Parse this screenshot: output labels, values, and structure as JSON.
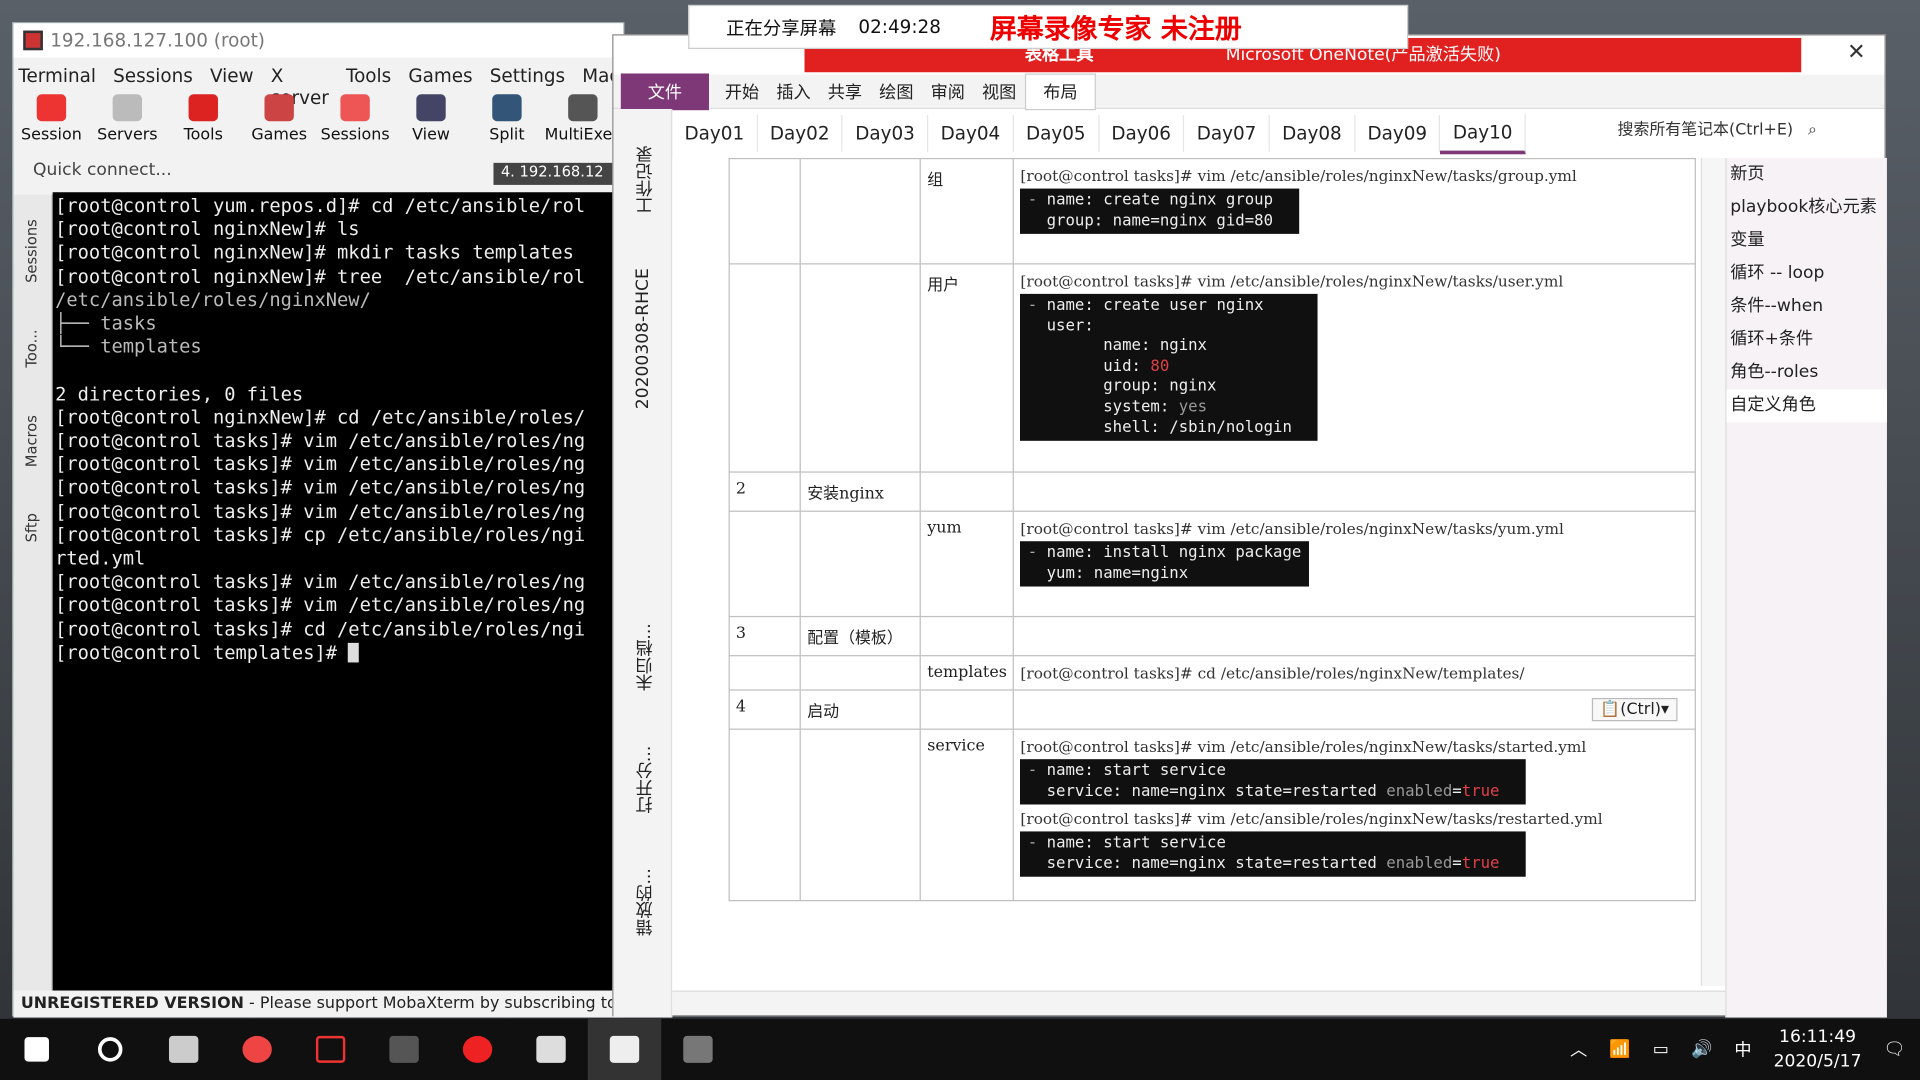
{
  "moba": {
    "title": "192.168.127.100 (root)",
    "menu": [
      "Terminal",
      "Sessions",
      "View",
      "X server",
      "Tools",
      "Games",
      "Settings",
      "Macros"
    ],
    "tools": [
      {
        "label": "Session",
        "color": "#e33"
      },
      {
        "label": "Servers",
        "color": "#bbb"
      },
      {
        "label": "Tools",
        "color": "#d22"
      },
      {
        "label": "Games",
        "color": "#c44"
      },
      {
        "label": "Sessions",
        "color": "#e55"
      },
      {
        "label": "View",
        "color": "#446"
      },
      {
        "label": "Split",
        "color": "#357"
      },
      {
        "label": "MultiExec",
        "color": "#555"
      }
    ],
    "quick_connect": "Quick connect...",
    "tab_label": "4. 192.168.12",
    "side_labels": {
      "sessions": "Sessions",
      "tools": "Too...",
      "macros": "Macros",
      "sftp": "Sftp"
    },
    "status": {
      "bold": "UNREGISTERED VERSION",
      "text": "-  Please support MobaXterm by subscribing to the p"
    },
    "terminal_lines": [
      "[root@control yum.repos.d]# cd /etc/ansible/rol",
      "[root@control nginxNew]# ls",
      "[root@control nginxNew]# mkdir tasks templates",
      "[root@control nginxNew]# tree  /etc/ansible/rol",
      "/etc/ansible/roles/nginxNew/",
      "├── tasks",
      "└── templates",
      "",
      "2 directories, 0 files",
      "[root@control nginxNew]# cd /etc/ansible/roles/",
      "[root@control tasks]# vim /etc/ansible/roles/ng",
      "[root@control tasks]# vim /etc/ansible/roles/ng",
      "[root@control tasks]# vim /etc/ansible/roles/ng",
      "[root@control tasks]# vim /etc/ansible/roles/ng",
      "[root@control tasks]# cp /etc/ansible/roles/ngi",
      "rted.yml",
      "[root@control tasks]# vim /etc/ansible/roles/ng",
      "[root@control tasks]# vim /etc/ansible/roles/ng",
      "[root@control tasks]# cd /etc/ansible/roles/ngi",
      "[root@control templates]# "
    ]
  },
  "share": {
    "label": "正在分享屏幕",
    "time": "02:49:28",
    "watermark": "屏幕录像专家 未注册"
  },
  "onenote": {
    "title_band": "Microsoft OneNote(产品激活失败)",
    "table_tools": "表格工具",
    "ribbon_tabs": [
      "文件",
      "开始",
      "插入",
      "共享",
      "绘图",
      "审阅",
      "视图",
      "布局"
    ],
    "notebook": "20200308-RHCE",
    "left_labels": {
      "work": "工作记录",
      "unfiled": "未归档...",
      "open": "打开分...",
      "misplaced": "错放的..."
    },
    "day_tabs": [
      "Day01",
      "Day02",
      "Day03",
      "Day04",
      "Day05",
      "Day06",
      "Day07",
      "Day08",
      "Day09",
      "Day10"
    ],
    "active_tab": "Day10",
    "search_placeholder": "搜索所有笔记本(Ctrl+E)",
    "pages": [
      "新页",
      "playbook核心元素",
      "变量",
      "循环 -- loop",
      "条件--when",
      "循环+条件",
      "角色--roles",
      "自定义角色"
    ],
    "selected_page": "自定义角色",
    "table": {
      "group_label": "组",
      "group_cmd": "[root@control tasks]# vim /etc/ansible/roles/nginxNew/tasks/group.yml",
      "user_label": "用户",
      "user_cmd": "[root@control tasks]# vim /etc/ansible/roles/nginxNew/tasks/user.yml",
      "row2_num": "2",
      "row2_label": "安装nginx",
      "yum_label": "yum",
      "yum_cmd": "[root@control tasks]# vim /etc/ansible/roles/nginxNew/tasks/yum.yml",
      "row3_num": "3",
      "row3_label": "配置（模板）",
      "templates_label": "templates",
      "templates_cmd": "[root@control tasks]# cd /etc/ansible/roles/nginxNew/templates/",
      "row4_num": "4",
      "row4_label": "启动",
      "ctrl_label": "(Ctrl)",
      "service_label": "service",
      "service_cmd1": "[root@control tasks]# vim /etc/ansible/roles/nginxNew/tasks/started.yml",
      "service_cmd2": "[root@control tasks]# vim /etc/ansible/roles/nginxNew/tasks/restarted.yml"
    }
  },
  "taskbar": {
    "ime": "中",
    "time": "16:11:49",
    "date": "2020/5/17"
  }
}
